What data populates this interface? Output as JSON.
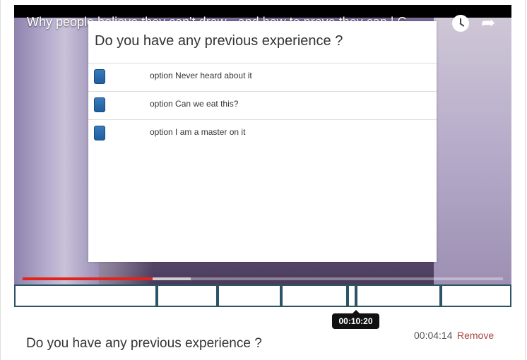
{
  "video": {
    "title": "Why people believe they can't draw - and how to prove they can | G...",
    "icons": {
      "clock": "clock-icon",
      "share": "share-icon"
    },
    "progress_played_pct": 27,
    "progress_buffer_pct": 35
  },
  "modal": {
    "question": "Do you have any previous experience ?",
    "options": [
      {
        "label": "option Never heard about it"
      },
      {
        "label": "option Can we eat this?"
      },
      {
        "label": "option I am a master on it"
      }
    ]
  },
  "timeline": {
    "tooltip_time": "00:10:20"
  },
  "question_row": {
    "title": "Do you have any previous experience ?",
    "time": "00:04:14",
    "remove_label": "Remove"
  },
  "colors": {
    "accent": "#2b5566",
    "progress": "#e62117",
    "remove": "#a94442",
    "checkbox": "#2a6fb0"
  }
}
